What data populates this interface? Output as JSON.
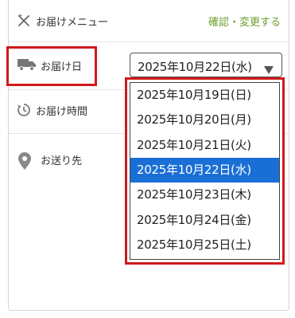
{
  "menu": {
    "label": "お届けメニュー",
    "icon": "cutlery-icon",
    "confirm_link": "確認・変更する"
  },
  "delivery_date": {
    "label": "お届け日",
    "icon": "truck-icon",
    "selected": "2025年10月22日(水)",
    "options": [
      "2025年10月19日(日)",
      "2025年10月20日(月)",
      "2025年10月21日(火)",
      "2025年10月22日(水)",
      "2025年10月23日(木)",
      "2025年10月24日(金)",
      "2025年10月25日(土)"
    ],
    "selected_index": 3
  },
  "delivery_time": {
    "label": "お届け時間",
    "icon": "clock-icon"
  },
  "address": {
    "label": "お送り先",
    "icon": "map-pin-icon"
  },
  "colors": {
    "accent_link": "#6b9f2f",
    "highlight": "#d0191b",
    "selected_option": "#1a6fd6"
  }
}
